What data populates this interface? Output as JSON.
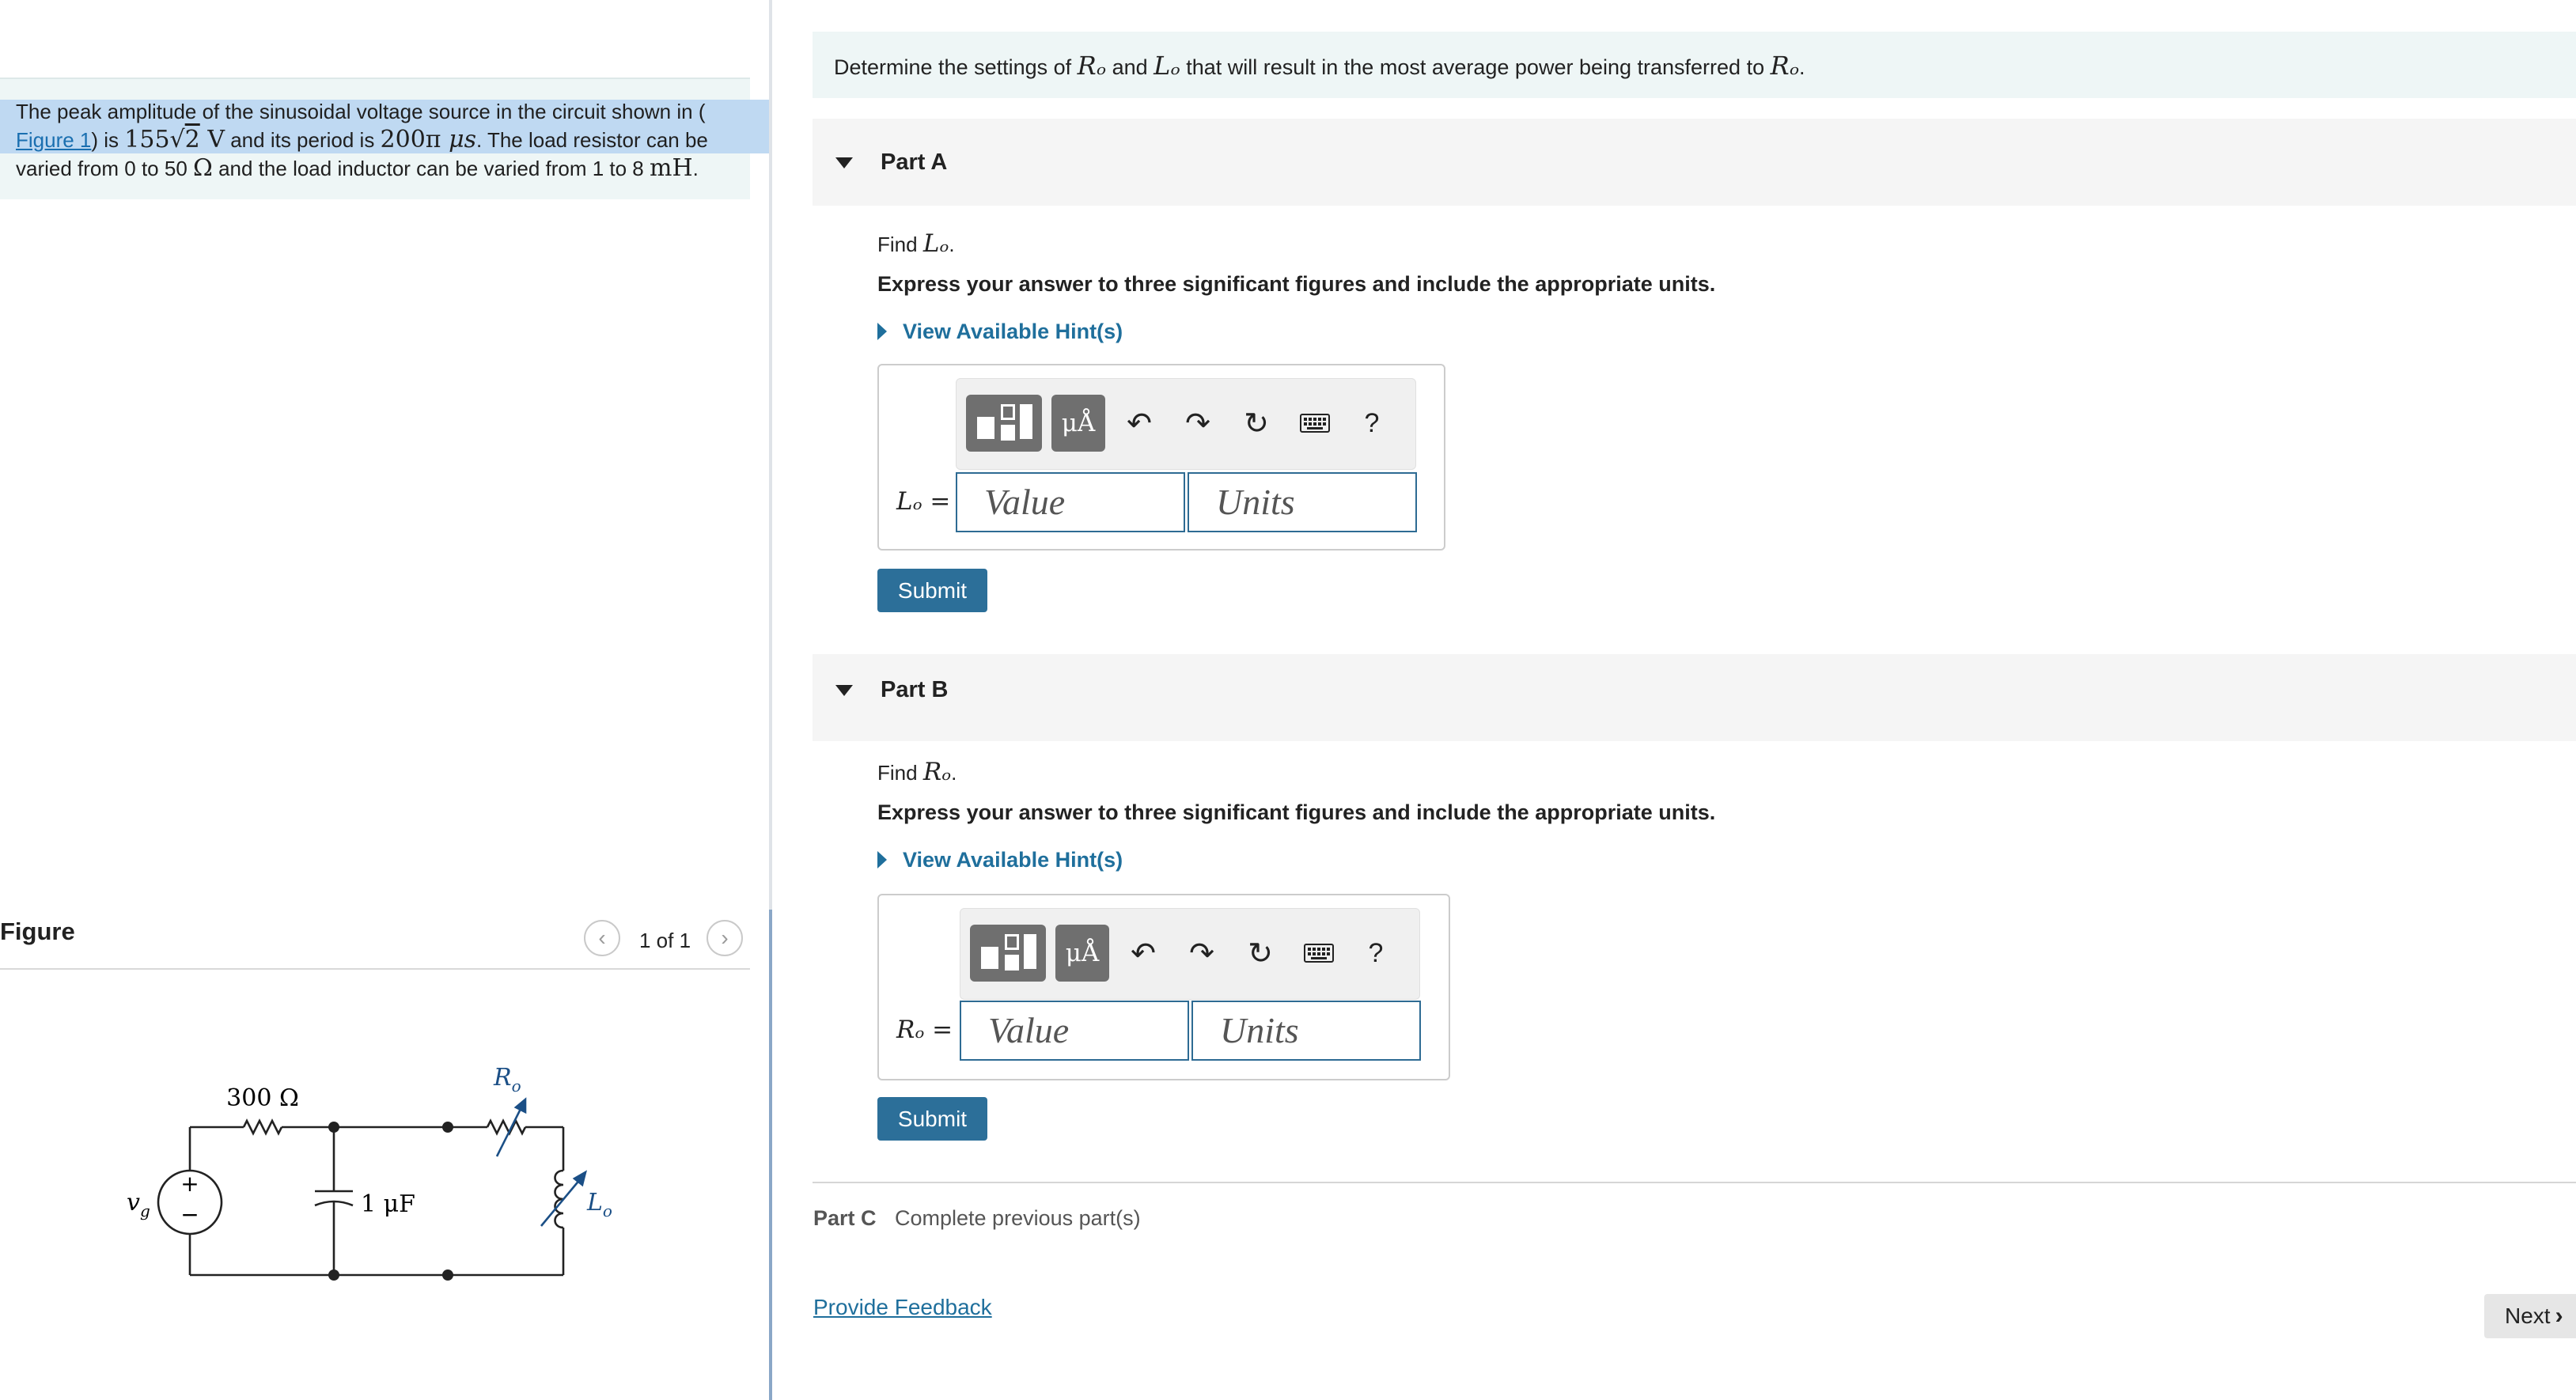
{
  "problem": {
    "intro_part1": "The peak amplitude of the sinusoidal voltage source in the circuit shown in (",
    "figure_link": "Figure 1",
    "intro_part2": ") is ",
    "amplitude_num": "155",
    "amplitude_rad": "2",
    "amplitude_unit": "V",
    "intro_part3": " and its period is ",
    "period_value": "200π",
    "period_unit": "μs",
    "intro_part4": ". The load resistor can be varied from 0 to 50 ",
    "ohm_symbol": "Ω",
    "intro_part5": " and the load inductor can be varied from 1 to 8 ",
    "mh_unit": "mH",
    "intro_end": "."
  },
  "figure": {
    "title": "Figure",
    "counter": "1 of 1",
    "prev_icon": "chevron-left-icon",
    "next_icon": "chevron-right-icon",
    "circuit": {
      "resistor_label": "300 Ω",
      "capacitor_label": "1 μF",
      "source_label": "v",
      "source_subscript": "g",
      "load_resistor_label": "R",
      "load_resistor_subscript": "o",
      "load_inductor_label": "L",
      "load_inductor_subscript": "o",
      "plus": "+",
      "minus": "−"
    }
  },
  "prompt": {
    "part1": "Determine the settings of ",
    "sym1": "Rₒ",
    "part2": " and ",
    "sym2": "Lₒ",
    "part3": " that will result in the most average power being transferred to ",
    "sym3": "Rₒ",
    "end": "."
  },
  "parts": [
    {
      "label": "Part A",
      "find_prefix": "Find ",
      "find_symbol": "Lₒ",
      "find_end": ".",
      "instructions": "Express your answer to three significant figures and include the appropriate units.",
      "hint_label": "View Available Hint(s)",
      "answer_label": "Lₒ =",
      "value_placeholder": "Value",
      "units_placeholder": "Units",
      "submit_label": "Submit"
    },
    {
      "label": "Part B",
      "find_prefix": "Find ",
      "find_symbol": "Rₒ",
      "find_end": ".",
      "instructions": "Express your answer to three significant figures and include the appropriate units.",
      "hint_label": "View Available Hint(s)",
      "answer_label": "Rₒ =",
      "value_placeholder": "Value",
      "units_placeholder": "Units",
      "submit_label": "Submit"
    }
  ],
  "toolbar": {
    "units_button": "μÅ",
    "undo_icon": "undo-icon",
    "redo_icon": "redo-icon",
    "reset_icon": "reset-icon",
    "keyboard_icon": "keyboard-icon",
    "help_label": "?"
  },
  "part_c": {
    "label": "Part C",
    "status": "Complete previous part(s)"
  },
  "footer": {
    "feedback_link": "Provide Feedback",
    "next_label": "Next"
  },
  "colors": {
    "accent": "#2c6f99",
    "link": "#1f6f9c",
    "panel_bg": "#eef6f6",
    "highlight": "#bfd9f2"
  }
}
